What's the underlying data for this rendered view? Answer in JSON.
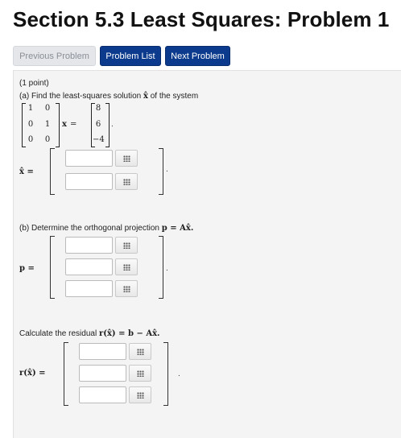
{
  "page": {
    "title": "Section 5.3 Least Squares: Problem 1"
  },
  "nav": {
    "previous_label": "Previous Problem",
    "list_label": "Problem List",
    "next_label": "Next Problem"
  },
  "problem": {
    "points": "(1 point)",
    "part_a_text": "(a) Find the least-squares solution",
    "part_a_xhat": "x̂",
    "part_a_suffix": "of the system",
    "matrix_A": [
      [
        "1",
        "0"
      ],
      [
        "0",
        "1"
      ],
      [
        "0",
        "0"
      ]
    ],
    "x_symbol": "x",
    "equals": "=",
    "vector_b": [
      "8",
      "6",
      "−4"
    ],
    "xhat_label": "x̂ =",
    "part_b_text": "(b) Determine the orthogonal projection",
    "part_b_formula": "p = Ax̂.",
    "p_label": "p =",
    "part_c_text": "Calculate the residual",
    "part_c_formula": "r(x̂) = b − Ax̂.",
    "r_label": "r(x̂) =",
    "period": "."
  },
  "icons": {
    "equation_editor": "grid-icon"
  },
  "colors": {
    "nav_active": "#0c3a8c",
    "nav_disabled": "#e4e6ea",
    "panel_bg": "#f4f4f4"
  }
}
